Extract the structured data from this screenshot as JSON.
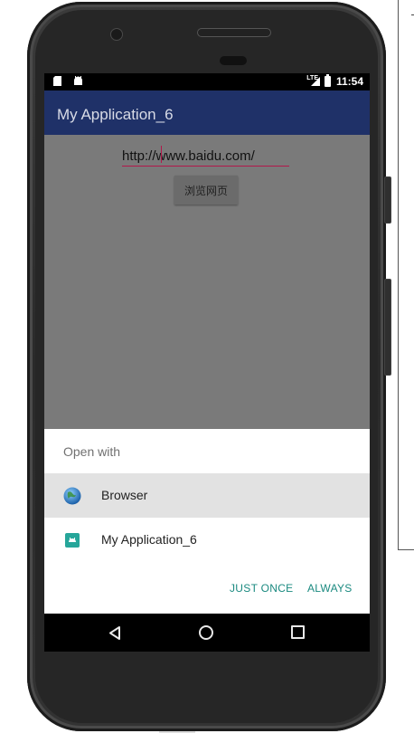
{
  "status_bar": {
    "time": "11:54",
    "network": "LTE",
    "left_icons": [
      "sd-card-icon",
      "android-notification-icon"
    ]
  },
  "app": {
    "title": "My Application_6",
    "accent_color": "#1f3168"
  },
  "form": {
    "url_value": "http://www.baidu.com/",
    "browse_button_label": "浏览网页"
  },
  "dialog": {
    "title": "Open with",
    "options": [
      {
        "label": "Browser",
        "icon": "globe-icon",
        "selected": true
      },
      {
        "label": "My Application_6",
        "icon": "android-app-icon",
        "selected": false
      }
    ],
    "just_once_label": "JUST ONCE",
    "always_label": "ALWAYS",
    "action_color": "#1b8a80"
  },
  "nav_bar": {
    "buttons": [
      "back-icon",
      "home-icon",
      "recents-icon"
    ]
  }
}
